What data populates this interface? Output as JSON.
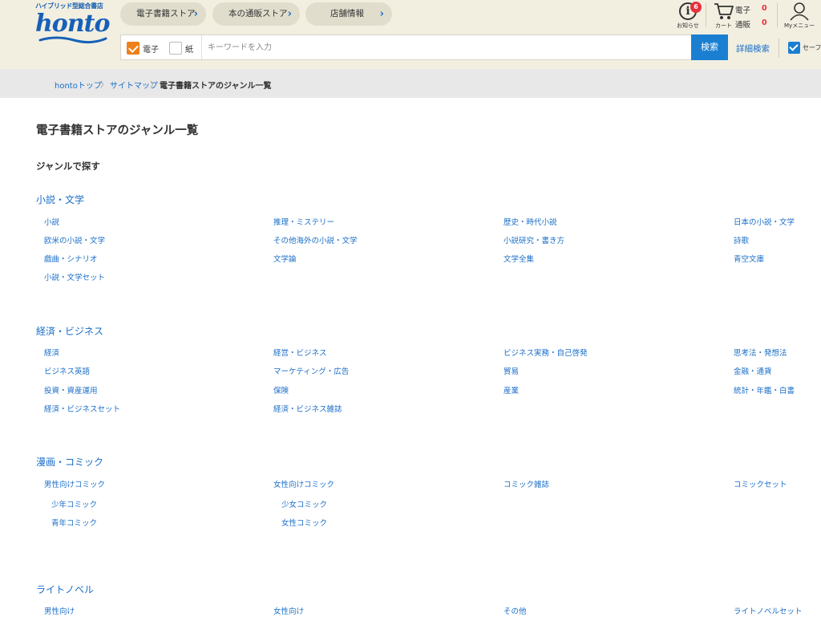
{
  "header": {
    "logo_tagline": "ハイブリッド型総合書店",
    "logo_text": "honto",
    "nav": [
      {
        "label": "電子書籍ストア"
      },
      {
        "label": "本の通販ストア"
      },
      {
        "label": "店舗情報"
      }
    ],
    "notifications": {
      "count": "6",
      "caption": "お知らせ"
    },
    "cart": {
      "caption": "カート",
      "ebook_label": "電子",
      "ebook_count": "0",
      "print_label": "通販",
      "print_count": "0"
    },
    "my_menu": {
      "caption": "Myメニュー"
    }
  },
  "search": {
    "ebook_label": "電子",
    "paper_label": "紙",
    "placeholder": "キーワードを入力",
    "button_label": "検索",
    "advanced_label": "詳細検索",
    "safe_label": "セーフ"
  },
  "colors": {
    "accent": "#1a7fd1",
    "link": "#1a6ec8",
    "header_bg": "#f2efe1",
    "orange": "#ef7f1a",
    "badge": "#e8303b"
  },
  "breadcrumb": [
    {
      "label": "hontoトップ"
    },
    {
      "label": "サイトマップ"
    },
    {
      "label": "電子書籍ストアのジャンル一覧"
    }
  ],
  "page_title": "電子書籍ストアのジャンル一覧",
  "section_heading": "ジャンルで探す",
  "categories": [
    {
      "title": "小説・文学",
      "items": [
        "小説",
        "推理・ミステリー",
        "歴史・時代小説",
        "日本の小説・文学",
        "欧米の小説・文学",
        "その他海外の小説・文学",
        "小説研究・書き方",
        "詩歌",
        "戯曲・シナリオ",
        "文学論",
        "文学全集",
        "青空文庫",
        "小説・文学セット"
      ]
    },
    {
      "title": "経済・ビジネス",
      "items": [
        "経済",
        "経営・ビジネス",
        "ビジネス実務・自己啓発",
        "思考法・発想法",
        "ビジネス英語",
        "マーケティング・広告",
        "貿易",
        "金融・通貨",
        "投資・資産運用",
        "保険",
        "産業",
        "統計・年鑑・白書",
        "経済・ビジネスセット",
        "経済・ビジネス雑誌"
      ]
    },
    {
      "title": "漫画・コミック",
      "items": [
        "男性向けコミック",
        "女性向けコミック",
        "コミック雑誌",
        "コミックセット"
      ],
      "sub_items": [
        "少年コミック",
        "少女コミック",
        "青年コミック",
        "女性コミック"
      ]
    },
    {
      "title": "ライトノベル",
      "items": [
        "男性向け",
        "女性向け",
        "その他",
        "ライトノベルセット"
      ]
    }
  ]
}
